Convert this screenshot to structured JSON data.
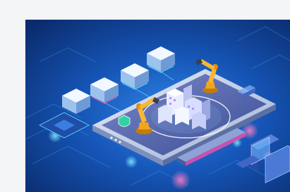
{
  "image": {
    "colors": {
      "background_dark": "#0a2a6b",
      "background_mid": "#1656b8",
      "background_light": "#2f86e6",
      "glow_cyan": "#5fe0ff",
      "phone_body": "#c8d4ea",
      "phone_screen": "#5b6fb0",
      "robot_arm": "#f2a51a",
      "accent_pink": "#ff4fa8",
      "accent_purple": "#8a5cff",
      "building": "#e8ecff"
    },
    "icons": [
      "robot-arm-icon",
      "server-cube-icon",
      "tablet-icon",
      "shield-icon",
      "chip-icon"
    ]
  }
}
